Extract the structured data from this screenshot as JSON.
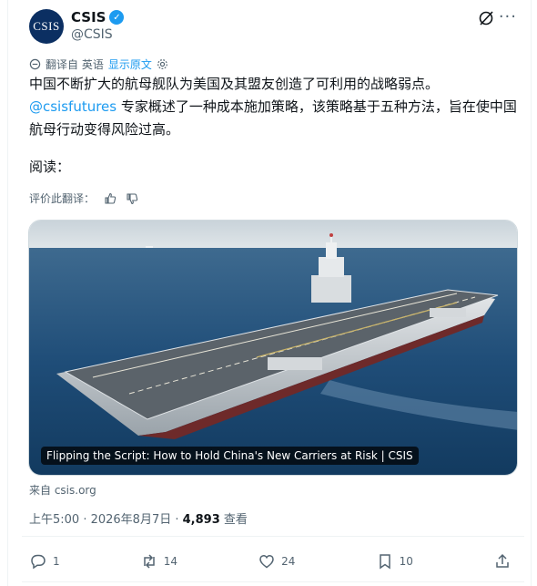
{
  "account": {
    "avatar_text": "CSIS",
    "name": "CSIS",
    "handle": "@CSIS"
  },
  "translation": {
    "label": "翻译自 英语",
    "show_original": "显示原文"
  },
  "tweet": {
    "line1": "中国不断扩大的航母舰队为美国及其盟友创造了可利用的战略弱点。",
    "mention": "@csisfutures",
    "line2_rest": " 专家概述了一种成本施加策略，该策略基于五种方法，旨在使中国航母行动变得风险过高。",
    "read": "阅读："
  },
  "rating": {
    "label": "评价此翻译："
  },
  "card": {
    "caption": "Flipping the Script: How to Hold China's New Carriers at Risk | CSIS",
    "source": "来自 csis.org"
  },
  "meta": {
    "time": "上午5:00 · 2026年8月7日 · ",
    "views": "4,893",
    "views_label": " 查看"
  },
  "actions": {
    "replies": "1",
    "reposts": "14",
    "likes": "24",
    "bookmarks": "10"
  },
  "colors": {
    "accent": "#1d9bf0",
    "text": "#0f1419",
    "muted": "#536471",
    "avatar_bg": "#0b2f62"
  }
}
